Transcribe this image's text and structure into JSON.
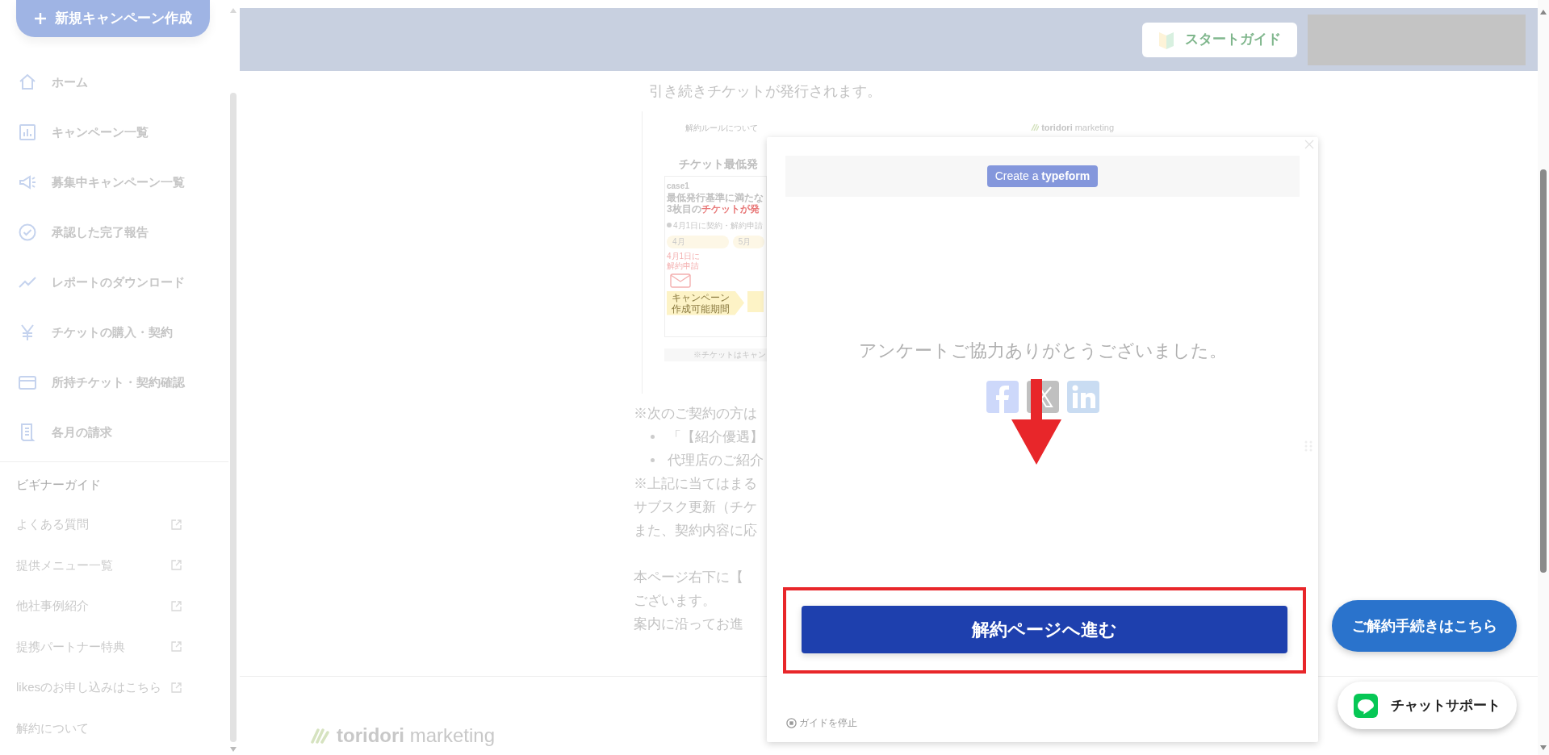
{
  "sidebar": {
    "new_button": "新規キャンペーン作成",
    "nav_items": [
      {
        "kind": "home",
        "label": "ホーム"
      },
      {
        "kind": "chart",
        "label": "キャンペーン一覧"
      },
      {
        "kind": "megaphone",
        "label": "募集中キャンペーン一覧"
      },
      {
        "kind": "check",
        "label": "承認した完了報告"
      },
      {
        "kind": "trend",
        "label": "レポートのダウンロード"
      },
      {
        "kind": "yen",
        "label": "チケットの購入・契約"
      },
      {
        "kind": "card",
        "label": "所持チケット・契約確認"
      },
      {
        "kind": "receipt",
        "label": "各月の請求"
      }
    ],
    "section_title": "ビギナーガイド",
    "links": [
      {
        "label": "よくある質問",
        "external": true
      },
      {
        "label": "提供メニュー一覧",
        "external": true
      },
      {
        "label": "他社事例紹介",
        "external": true
      },
      {
        "label": "提携パートナー特典",
        "external": true
      },
      {
        "label": "likesのお申し込みはこちら",
        "external": true
      },
      {
        "label": "解約について",
        "external": false
      }
    ]
  },
  "header": {
    "start_guide": "スタートガイド"
  },
  "content": {
    "paragraph": "引き続きチケットが発行されます。",
    "document": {
      "title": "解約ルールについて",
      "logo_brand": "toridori",
      "logo_suffix": "marketing",
      "heading": "チケット最低発",
      "case_label": "case1",
      "line_1": "最低発行基準に満たな",
      "line_2_prefix": "3枚目の",
      "line_2_highlight": "チケットが発",
      "timeline_note": "4月1日に契約・解約申請",
      "months": [
        "4月",
        "5月"
      ],
      "cancel_note": [
        "4月1日に",
        "解約申請"
      ],
      "period_label": [
        "キャンペーン",
        "作成可能期間"
      ],
      "footnote": "※チケットはキャン"
    },
    "notes_intro": "※次のご契約の方は",
    "bullets": [
      "「【紹介優遇】",
      "代理店のご紹介"
    ],
    "notes": [
      "※上記に当てはまる",
      "サブスク更新（チケ",
      "また、契約内容に応"
    ],
    "closing": [
      "本ページ右下に【",
      "ございます。",
      "案内に沿ってお進"
    ]
  },
  "footer": {
    "logo_brand": "toridori",
    "logo_suffix": "marketing"
  },
  "modal": {
    "banner_button": "Create a **typeform**",
    "message": "アンケートご協力ありがとうございました。",
    "cta": "解約ページへ進む",
    "stop_guide": "ガイドを停止"
  },
  "floating": {
    "cancel_button": "ご解約手続きはこちら",
    "chat_button": "チャットサポート"
  }
}
